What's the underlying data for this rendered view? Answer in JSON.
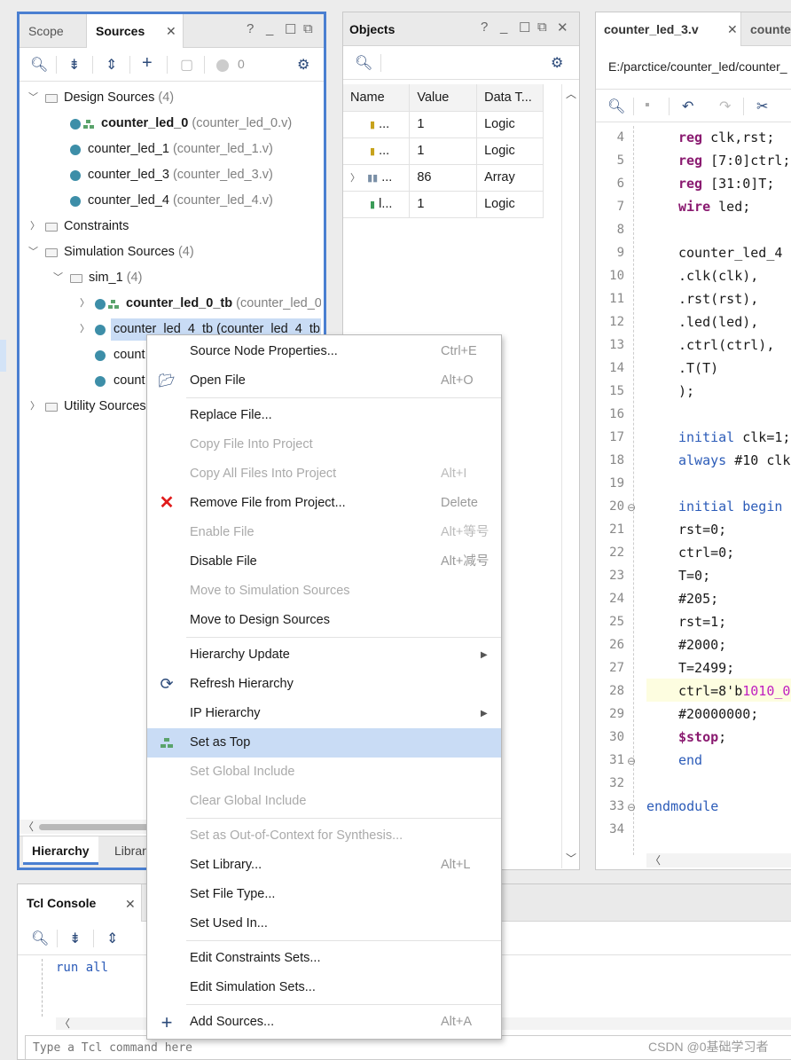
{
  "sources": {
    "tabs": [
      "Scope",
      "Sources"
    ],
    "badge_count": "0",
    "tree": {
      "design_sources": {
        "label": "Design Sources",
        "count": "(4)"
      },
      "design_items": [
        {
          "name": "counter_led_0",
          "file": "(counter_led_0.v)",
          "bold": true
        },
        {
          "name": "counter_led_1",
          "file": "(counter_led_1.v)"
        },
        {
          "name": "counter_led_3",
          "file": "(counter_led_3.v)"
        },
        {
          "name": "counter_led_4",
          "file": "(counter_led_4.v)"
        }
      ],
      "constraints": "Constraints",
      "simulation_sources": {
        "label": "Simulation Sources",
        "count": "(4)"
      },
      "sim_1": {
        "label": "sim_1",
        "count": "(4)"
      },
      "sim_items": [
        {
          "name": "counter_led_0_tb",
          "file": "(counter_led_0"
        },
        {
          "name": "counter_led_4_tb",
          "file": "(counter_led_4_tb."
        },
        {
          "name": "count"
        },
        {
          "name": "count"
        }
      ],
      "utility_sources": "Utility Sources"
    },
    "bottom_tabs": [
      "Hierarchy",
      "Librar"
    ]
  },
  "objects": {
    "title": "Objects",
    "columns": [
      "Name",
      "Value",
      "Data T..."
    ],
    "rows": [
      {
        "name": "...",
        "value": "1",
        "type": "Logic"
      },
      {
        "name": "...",
        "value": "1",
        "type": "Logic"
      },
      {
        "name": "...",
        "value": "86",
        "type": "Array"
      },
      {
        "name": "l...",
        "value": "1",
        "type": "Logic"
      }
    ]
  },
  "editor": {
    "tabs": [
      "counter_led_3.v",
      "counte"
    ],
    "path": "E:/parctice/counter_led/counter_",
    "lines": [
      {
        "n": "4",
        "parts": [
          [
            "kw",
            "reg"
          ],
          [
            "",
            " clk,rst;"
          ]
        ]
      },
      {
        "n": "5",
        "parts": [
          [
            "kw",
            "reg"
          ],
          [
            "",
            " [7:0]ctrl;"
          ]
        ]
      },
      {
        "n": "6",
        "parts": [
          [
            "kw",
            "reg"
          ],
          [
            "",
            " [31:0]T;"
          ]
        ]
      },
      {
        "n": "7",
        "parts": [
          [
            "kw",
            "wire"
          ],
          [
            "",
            " led;"
          ]
        ]
      },
      {
        "n": "8",
        "parts": []
      },
      {
        "n": "9",
        "parts": [
          [
            "",
            "counter_led_4"
          ]
        ]
      },
      {
        "n": "10",
        "parts": [
          [
            "",
            ".clk(clk),"
          ]
        ]
      },
      {
        "n": "11",
        "parts": [
          [
            "",
            ".rst(rst),"
          ]
        ]
      },
      {
        "n": "12",
        "parts": [
          [
            "",
            ".led(led),"
          ]
        ]
      },
      {
        "n": "13",
        "parts": [
          [
            "",
            ".ctrl(ctrl),"
          ]
        ]
      },
      {
        "n": "14",
        "parts": [
          [
            "",
            ".T(T)"
          ]
        ]
      },
      {
        "n": "15",
        "parts": [
          [
            "",
            ");"
          ]
        ]
      },
      {
        "n": "16",
        "parts": []
      },
      {
        "n": "17",
        "parts": [
          [
            "kw2",
            "initial"
          ],
          [
            "",
            " clk=1;"
          ]
        ]
      },
      {
        "n": "18",
        "parts": [
          [
            "kw2",
            "always"
          ],
          [
            "",
            " #10 clk="
          ]
        ]
      },
      {
        "n": "19",
        "parts": []
      },
      {
        "n": "20",
        "parts": [
          [
            "kw2",
            "initial begin"
          ]
        ]
      },
      {
        "n": "21",
        "parts": [
          [
            "",
            "rst=0;"
          ]
        ]
      },
      {
        "n": "22",
        "parts": [
          [
            "",
            "ctrl=0;"
          ]
        ]
      },
      {
        "n": "23",
        "parts": [
          [
            "",
            "T=0;"
          ]
        ]
      },
      {
        "n": "24",
        "parts": [
          [
            "",
            "#205;"
          ]
        ]
      },
      {
        "n": "25",
        "parts": [
          [
            "",
            "rst=1;"
          ]
        ]
      },
      {
        "n": "26",
        "parts": [
          [
            "",
            "#2000;"
          ]
        ]
      },
      {
        "n": "27",
        "parts": [
          [
            "",
            "T=2499;"
          ]
        ]
      },
      {
        "n": "28",
        "parts": [
          [
            "",
            "ctrl=8'b"
          ],
          [
            "str",
            "1010_0"
          ]
        ]
      },
      {
        "n": "29",
        "parts": [
          [
            "",
            "#20000000;"
          ]
        ]
      },
      {
        "n": "30",
        "parts": [
          [
            "kw",
            "$stop"
          ],
          [
            "",
            ";"
          ]
        ]
      },
      {
        "n": "31",
        "parts": [
          [
            "kw2",
            "end"
          ]
        ]
      },
      {
        "n": "32",
        "parts": []
      },
      {
        "n": "33",
        "parts": [
          [
            "kw2",
            "endmodule"
          ]
        ]
      },
      {
        "n": "34",
        "parts": []
      }
    ]
  },
  "tcl": {
    "title": "Tcl Console",
    "output": "run all",
    "placeholder": "Type a Tcl command here"
  },
  "context_menu": [
    {
      "label": "Source Node Properties...",
      "shortcut": "Ctrl+E"
    },
    {
      "label": "Open File",
      "shortcut": "Alt+O",
      "icon": "folder-icon"
    },
    {
      "sep": true
    },
    {
      "label": "Replace File..."
    },
    {
      "label": "Copy File Into Project",
      "disabled": true
    },
    {
      "label": "Copy All Files Into Project",
      "shortcut": "Alt+I",
      "disabled": true
    },
    {
      "label": "Remove File from Project...",
      "shortcut": "Delete",
      "icon": "remove-icon"
    },
    {
      "label": "Enable File",
      "shortcut": "Alt+等号",
      "disabled": true
    },
    {
      "label": "Disable File",
      "shortcut": "Alt+减号"
    },
    {
      "label": "Move to Simulation Sources",
      "disabled": true
    },
    {
      "label": "Move to Design Sources"
    },
    {
      "sep": true
    },
    {
      "label": "Hierarchy Update",
      "submenu": true
    },
    {
      "label": "Refresh Hierarchy",
      "icon": "refresh-icon"
    },
    {
      "label": "IP Hierarchy",
      "submenu": true
    },
    {
      "label": "Set as Top",
      "selected": true,
      "icon": "hierarchy-icon"
    },
    {
      "label": "Set Global Include",
      "disabled": true
    },
    {
      "label": "Clear Global Include",
      "disabled": true
    },
    {
      "sep": true
    },
    {
      "label": "Set as Out-of-Context for Synthesis...",
      "disabled": true
    },
    {
      "label": "Set Library...",
      "shortcut": "Alt+L"
    },
    {
      "label": "Set File Type..."
    },
    {
      "label": "Set Used In..."
    },
    {
      "sep": true
    },
    {
      "label": "Edit Constraints Sets..."
    },
    {
      "label": "Edit Simulation Sets..."
    },
    {
      "sep": true
    },
    {
      "label": "Add Sources...",
      "shortcut": "Alt+A",
      "icon": "add-icon"
    }
  ],
  "watermark": "CSDN @0基础学习者"
}
